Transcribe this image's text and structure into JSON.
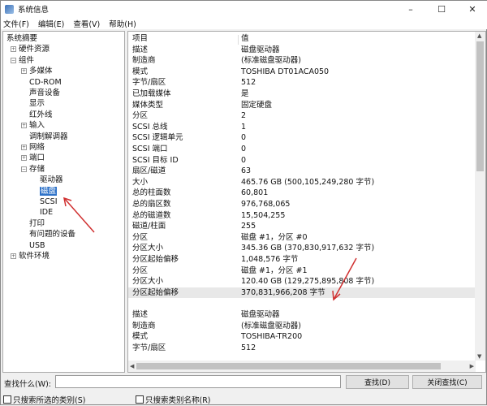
{
  "window": {
    "title": "系统信息",
    "minimize": "–",
    "maximize": "☐",
    "close": "✕"
  },
  "menu": [
    "文件(F)",
    "编辑(E)",
    "查看(V)",
    "帮助(H)"
  ],
  "tree": [
    {
      "label": "系统摘要",
      "level": 0,
      "expander": ""
    },
    {
      "label": "硬件资源",
      "level": 1,
      "expander": "+"
    },
    {
      "label": "组件",
      "level": 1,
      "expander": "-"
    },
    {
      "label": "多媒体",
      "level": 2,
      "expander": "+"
    },
    {
      "label": "CD-ROM",
      "level": 2,
      "expander": ""
    },
    {
      "label": "声音设备",
      "level": 2,
      "expander": ""
    },
    {
      "label": "显示",
      "level": 2,
      "expander": ""
    },
    {
      "label": "红外线",
      "level": 2,
      "expander": ""
    },
    {
      "label": "输入",
      "level": 2,
      "expander": "+"
    },
    {
      "label": "调制解调器",
      "level": 2,
      "expander": ""
    },
    {
      "label": "网络",
      "level": 2,
      "expander": "+"
    },
    {
      "label": "端口",
      "level": 2,
      "expander": "+"
    },
    {
      "label": "存储",
      "level": 2,
      "expander": "-"
    },
    {
      "label": "驱动器",
      "level": 3,
      "expander": ""
    },
    {
      "label": "磁盘",
      "level": 3,
      "expander": "",
      "selected": true
    },
    {
      "label": "SCSI",
      "level": 3,
      "expander": ""
    },
    {
      "label": "IDE",
      "level": 3,
      "expander": ""
    },
    {
      "label": "打印",
      "level": 2,
      "expander": ""
    },
    {
      "label": "有问题的设备",
      "level": 2,
      "expander": ""
    },
    {
      "label": "USB",
      "level": 2,
      "expander": ""
    },
    {
      "label": "软件环境",
      "level": 1,
      "expander": "+"
    }
  ],
  "columns": [
    "项目",
    "值"
  ],
  "rows": [
    [
      "描述",
      "磁盘驱动器"
    ],
    [
      "制造商",
      "(标准磁盘驱动器)"
    ],
    [
      "模式",
      "TOSHIBA DT01ACA050"
    ],
    [
      "字节/扇区",
      "512"
    ],
    [
      "已加载媒体",
      "是"
    ],
    [
      "媒体类型",
      "固定硬盘"
    ],
    [
      "分区",
      "2"
    ],
    [
      "SCSI 总线",
      "1"
    ],
    [
      "SCSI 逻辑单元",
      "0"
    ],
    [
      "SCSI 端口",
      "0"
    ],
    [
      "SCSI 目标 ID",
      "0"
    ],
    [
      "扇区/磁道",
      "63"
    ],
    [
      "大小",
      "465.76 GB (500,105,249,280 字节)"
    ],
    [
      "总的柱面数",
      "60,801"
    ],
    [
      "总的扇区数",
      "976,768,065"
    ],
    [
      "总的磁道数",
      "15,504,255"
    ],
    [
      "磁道/柱面",
      "255"
    ],
    [
      "分区",
      "磁盘 #1，分区 #0"
    ],
    [
      "分区大小",
      "345.36 GB (370,830,917,632 字节)"
    ],
    [
      "分区起始偏移",
      "1,048,576 字节"
    ],
    [
      "分区",
      "磁盘 #1，分区 #1"
    ],
    [
      "分区大小",
      "120.40 GB (129,275,895,808 字节)"
    ],
    [
      "分区起始偏移",
      "370,831,966,208 字节"
    ],
    [
      "",
      ""
    ],
    [
      "描述",
      "磁盘驱动器"
    ],
    [
      "制造商",
      "(标准磁盘驱动器)"
    ],
    [
      "模式",
      "TOSHIBA-TR200"
    ],
    [
      "字节/扇区",
      "512"
    ]
  ],
  "highlighted_row": 22,
  "find": {
    "label": "查找什么(W):",
    "value": "",
    "find_button": "查找(D)",
    "close_button": "关闭查找(C)",
    "only_selected": "只搜索所选的类别(S)",
    "only_names": "只搜索类别名称(R)"
  },
  "colors": {
    "selection": "#2f73c9",
    "annotation_arrow": "#d03030"
  }
}
